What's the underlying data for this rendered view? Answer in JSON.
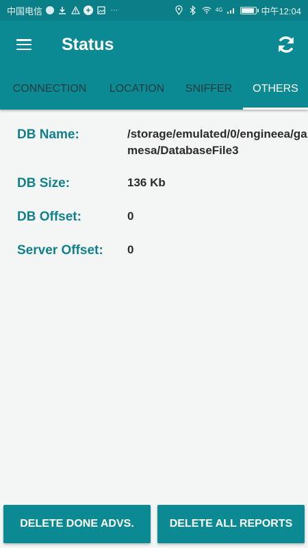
{
  "status_bar": {
    "carrier": "中国电信",
    "time": "中午12:04",
    "network_type": "4G",
    "icons_left": [
      "carrier-circle-icon",
      "download-icon",
      "warning-icon",
      "plus-circle-icon",
      "image-icon",
      "more-dots-icon"
    ],
    "icons_right": [
      "location-icon",
      "bluetooth-icon",
      "wifi-icon",
      "signal-icon",
      "battery-icon"
    ]
  },
  "app_bar": {
    "title": "Status",
    "menu_icon": "hamburger-menu-icon",
    "refresh_icon": "refresh-icon"
  },
  "tabs": [
    {
      "label": "CONNECTION",
      "active": false
    },
    {
      "label": "LOCATION",
      "active": false
    },
    {
      "label": "SNIFFER",
      "active": false
    },
    {
      "label": "OTHERS",
      "active": true
    }
  ],
  "details": [
    {
      "label": "DB Name:",
      "value": "/storage/emulated/0/engineea/gamesa/DatabaseFile3"
    },
    {
      "label": "DB Size:",
      "value": "136 Kb"
    },
    {
      "label": "DB Offset:",
      "value": "0"
    },
    {
      "label": "Server Offset:",
      "value": "0"
    }
  ],
  "buttons": {
    "delete_done": "DELETE DONE ADVS.",
    "delete_all": "DELETE ALL REPORTS"
  },
  "colors": {
    "primary": "#0b8a93",
    "status_bar": "#0b7f87",
    "label_accent": "#11808c",
    "background": "#f4f6f6"
  }
}
